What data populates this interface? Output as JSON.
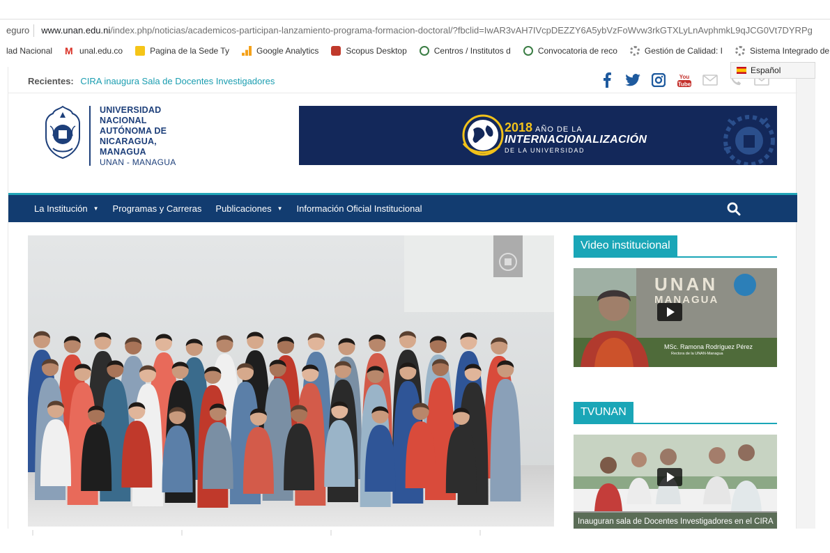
{
  "browser": {
    "secure_label": "eguro",
    "url_host": "www.unan.edu.ni",
    "url_path": "/index.php/noticias/academicos-participan-lanzamiento-programa-formacion-doctoral/?fbclid=IwAR3vAH7IVcpDEZZY6A5ybVzFoWvw3rkGTXLyLnAvphmkL9qJCG0Vt7DYRPg",
    "bookmarks": [
      {
        "label": "lad Nacional",
        "icon": "bookmark-icon",
        "color": "#b0b0b0"
      },
      {
        "label": "unal.edu.co",
        "icon": "gmail-icon",
        "color": "#d93025"
      },
      {
        "label": "Pagina de la Sede Ty",
        "icon": "folder-icon",
        "color": "#f5c518"
      },
      {
        "label": "Google Analytics",
        "icon": "analytics-icon",
        "color": "#f4a11a"
      },
      {
        "label": "Scopus Desktop",
        "icon": "scopus-icon",
        "color": "#c0392b"
      },
      {
        "label": "Centros / Institutos d",
        "icon": "crest-icon",
        "color": "#3a7d44"
      },
      {
        "label": "Convocatoria de reco",
        "icon": "crest-icon",
        "color": "#3a7d44"
      },
      {
        "label": "Gestión de Calidad: I",
        "icon": "gear-icon",
        "color": "#888888"
      },
      {
        "label": "Sistema Integrado de",
        "icon": "gear-icon",
        "color": "#888888"
      }
    ],
    "language": "Español"
  },
  "header": {
    "recent_label": "Recientes:",
    "recent_link": "CIRA inaugura Sala de Docentes Investigadores",
    "university_lines": [
      "UNIVERSIDAD",
      "NACIONAL",
      "AUTÓNOMA DE",
      "NICARAGUA,",
      "MANAGUA"
    ],
    "university_sub": "UNAN - MANAGUA",
    "banner_year": "2018",
    "banner_year_suffix": "AÑO DE LA",
    "banner_main": "INTERNACIONALIZACIÓN",
    "banner_sub": "DE LA UNIVERSIDAD",
    "social_icons": [
      "facebook-icon",
      "twitter-icon",
      "instagram-icon",
      "youtube-icon",
      "mail-icon",
      "phone-icon",
      "mail-icon"
    ],
    "colors": {
      "brand": "#1d3f7a",
      "accent": "#1aa6b7",
      "nav": "#123c70",
      "link": "#1a9db0"
    }
  },
  "nav": {
    "items": [
      {
        "label": "La Institución",
        "dropdown": true
      },
      {
        "label": "Programas y Carreras",
        "dropdown": false
      },
      {
        "label": "Publicaciones",
        "dropdown": true
      },
      {
        "label": "Información Oficial Institucional",
        "dropdown": false
      }
    ]
  },
  "sidebar": {
    "video_title": "Video institucional",
    "video_sign": "UNAN",
    "video_sign_sub": "MANAGUA",
    "video_caption_name": "MSc. Ramona Rodríguez Pérez",
    "video_caption_role": "Rectora de la UNAN-Managua",
    "tv_title": "TVUNAN",
    "tv_caption": "Inauguran sala de Docentes Investigadores en el CIRA"
  }
}
